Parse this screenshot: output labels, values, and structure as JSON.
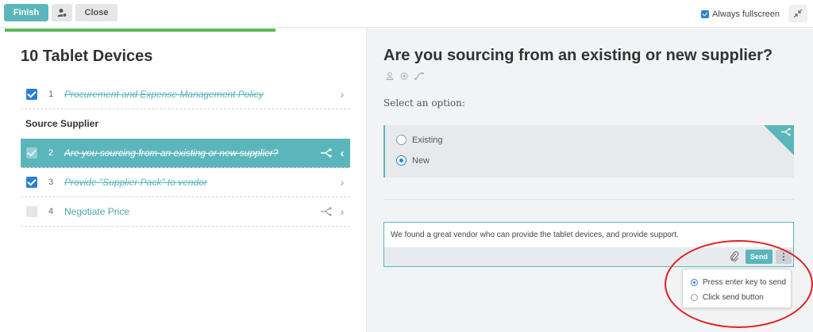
{
  "toolbar": {
    "finish_label": "Finish",
    "close_label": "Close",
    "fullscreen_label": "Always fullscreen",
    "fullscreen_checked": true
  },
  "checklist": {
    "title": "10 Tablet Devices",
    "section_heading": "Source Supplier",
    "tasks": [
      {
        "num": "1",
        "label": "Procurement and Expense Management Policy",
        "completed": true
      },
      {
        "num": "2",
        "label": "Are you sourcing from an existing or new supplier?",
        "completed": true,
        "active": true
      },
      {
        "num": "3",
        "label": "Provide \"Supplier Pack\" to vendor",
        "completed": true
      },
      {
        "num": "4",
        "label": "Negotiate Price",
        "completed": false
      }
    ]
  },
  "question": {
    "title": "Are you sourcing from an existing or new supplier?",
    "select_label": "Select an option:",
    "options": [
      {
        "label": "Existing",
        "selected": false
      },
      {
        "label": "New",
        "selected": true
      }
    ]
  },
  "comment": {
    "text": "We found a great vendor who can provide the tablet devices, and provide support.",
    "send_label": "Send",
    "menu_options": [
      {
        "label": "Press enter key to send",
        "selected": true
      },
      {
        "label": "Click send button",
        "selected": false
      }
    ]
  },
  "colors": {
    "accent": "#5bb6bc",
    "progress": "#5cb85c",
    "checkbox": "#2a7fd4",
    "highlight": "#e02020"
  }
}
